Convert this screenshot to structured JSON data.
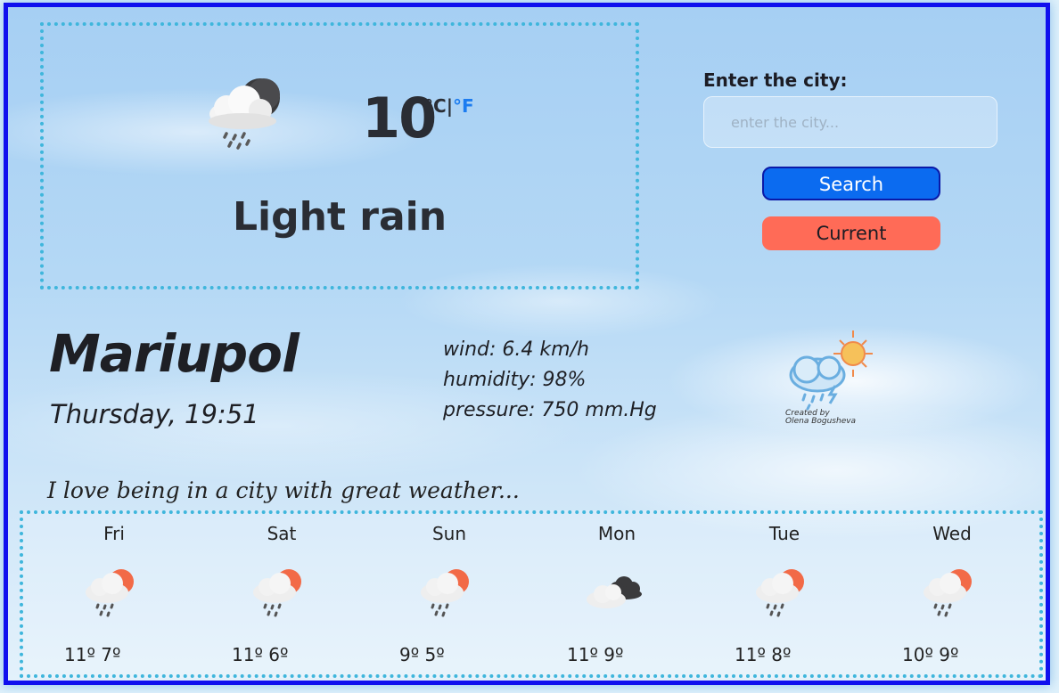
{
  "current": {
    "temperature": "10",
    "unit_c": "°C",
    "unit_sep": "|",
    "unit_f": "°F",
    "description": "Light rain",
    "icon": "rain-cloud-night-icon"
  },
  "search": {
    "label": "Enter the city:",
    "placeholder": "enter the city...",
    "value": "",
    "search_button": "Search",
    "current_button": "Current"
  },
  "location": {
    "city": "Mariupol",
    "datetime": "Thursday, 19:51"
  },
  "details": {
    "wind": "wind: 6.4 km/h",
    "humidity": "humidity: 98%",
    "pressure": "pressure: 750 mm.Hg"
  },
  "logo": {
    "icon": "logo-cloud-sun-icon",
    "line1": "Created by",
    "line2": "Olena Bogusheva"
  },
  "slogan": "I love being in a city with great weather...",
  "forecast": [
    {
      "day": "Fri",
      "temps": "11º 7º",
      "icon": "rain-sun-icon"
    },
    {
      "day": "Sat",
      "temps": "11º 6º",
      "icon": "rain-sun-icon"
    },
    {
      "day": "Sun",
      "temps": "9º 5º",
      "icon": "rain-sun-icon"
    },
    {
      "day": "Mon",
      "temps": "11º 9º",
      "icon": "cloudy-icon"
    },
    {
      "day": "Tue",
      "temps": "11º 8º",
      "icon": "rain-sun-icon"
    },
    {
      "day": "Wed",
      "temps": "10º 9º",
      "icon": "rain-sun-icon"
    }
  ],
  "colors": {
    "frame_border": "#1010ee",
    "dotted_border": "#3fb6dc",
    "search_button": "#0b6bf0",
    "current_button": "#ff6b57",
    "fahrenheit_link": "#1c7cf0"
  }
}
